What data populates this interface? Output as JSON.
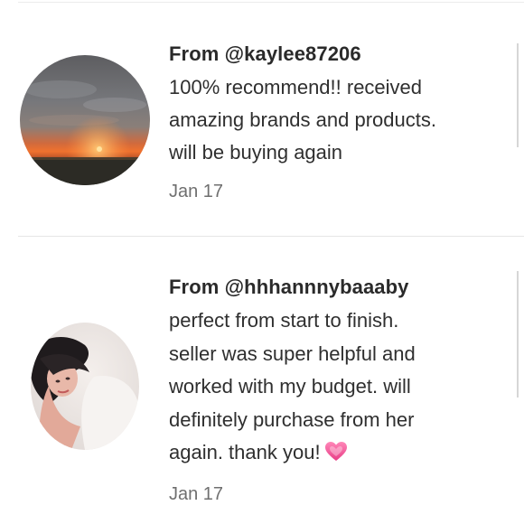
{
  "reviews": [
    {
      "from": "From @kaylee87206",
      "text": "100% recommend!! received\namazing brands and products.\nwill be buying again",
      "date": "Jan 17",
      "avatar": "sunset-photo-avatar"
    },
    {
      "from": "From @hhhannnybaaaby",
      "text": "perfect from start to finish.\nseller was super helpful and\nworked with my budget. will\ndefinitely purchase from her\nagain. thank you!",
      "emoji": "💗",
      "date": "Jan 17",
      "avatar": "portrait-photo-avatar"
    }
  ],
  "colors": {
    "text": "#2b2b2b",
    "date": "#6f6f6f",
    "divider": "#e6e6e6",
    "heart": "#f0589a"
  }
}
